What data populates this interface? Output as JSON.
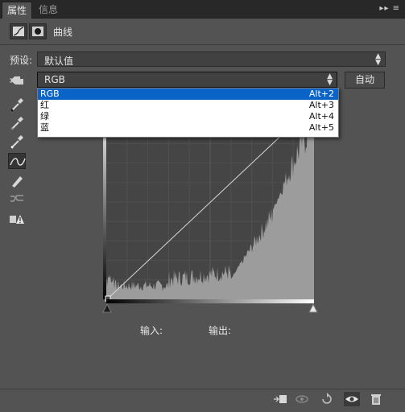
{
  "tabs": [
    {
      "label": "属性"
    },
    {
      "label": "信息"
    }
  ],
  "panel_menu_glyph": "▸▸ ≡",
  "adjustment": {
    "title": "曲线"
  },
  "preset": {
    "label": "预设:",
    "value": "默认值"
  },
  "channel": {
    "value": "RGB"
  },
  "auto_button": "自动",
  "channel_menu": [
    {
      "label": "RGB",
      "shortcut": "Alt+2"
    },
    {
      "label": "红",
      "shortcut": "Alt+3"
    },
    {
      "label": "绿",
      "shortcut": "Alt+4"
    },
    {
      "label": "蓝",
      "shortcut": "Alt+5"
    }
  ],
  "input_label": "输入:",
  "output_label": "输出:",
  "tools": [
    "hand-scrubber-icon",
    "black-point-eyedropper-icon",
    "gray-point-eyedropper-icon",
    "white-point-eyedropper-icon",
    "curve-point-icon",
    "pencil-icon",
    "smooth-icon",
    "clipping-warning-icon"
  ],
  "bottom_icons": [
    "clip-to-layer-icon",
    "view-previous-icon",
    "reset-icon",
    "visibility-icon",
    "trash-icon"
  ],
  "colors": {
    "panel": "#535353",
    "graph_bg": "#454545",
    "histogram": "#9c9c9c",
    "highlight": "#0a64c8"
  }
}
